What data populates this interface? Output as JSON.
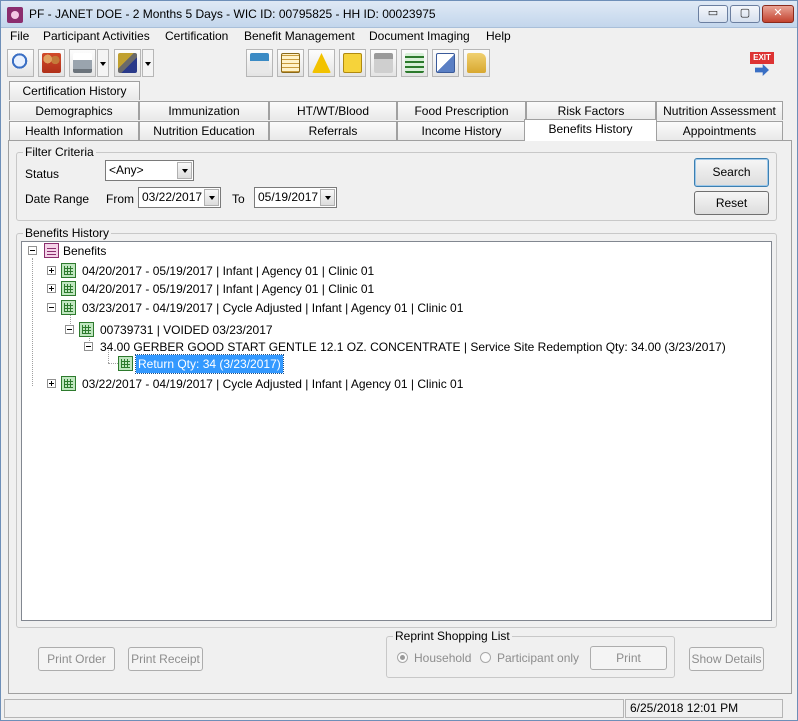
{
  "window": {
    "title": "PF - JANET DOE - 2 Months 5 Days - WIC ID: 00795825 - HH ID: 00023975",
    "minimize": "▭",
    "restore": "▢",
    "close": "✕"
  },
  "menu": [
    "File",
    "Participant Activities",
    "Certification",
    "Benefit Management",
    "Document Imaging",
    "Help"
  ],
  "toolbar": {
    "icons": [
      "search-icon",
      "family-icon",
      "printer-icon",
      "tools-icon",
      "calculator-icon",
      "calendar-icon",
      "warning-icon",
      "notes-icon",
      "card-icon",
      "check-icon",
      "documents-icon",
      "folder-icon"
    ],
    "exit_label": "EXIT"
  },
  "tabs": {
    "row1": [
      "Certification History"
    ],
    "row2": [
      "Demographics",
      "Immunization",
      "HT/WT/Blood",
      "Food Prescription",
      "Risk Factors",
      "Nutrition Assessment"
    ],
    "row3": [
      "Health Information",
      "Nutrition Education",
      "Referrals",
      "Income History",
      "Benefits History",
      "Appointments"
    ],
    "active": "Benefits History"
  },
  "filter": {
    "legend": "Filter Criteria",
    "status_label": "Status",
    "status_value": "<Any>",
    "date_range_label": "Date Range",
    "from_label": "From",
    "from_value": "03/22/2017",
    "to_label": "To",
    "to_value": "05/19/2017",
    "search_label": "Search",
    "reset_label": "Reset"
  },
  "history": {
    "legend": "Benefits History",
    "root": "Benefits",
    "rows": [
      "04/20/2017 - 05/19/2017  |  Infant  |  Agency 01  |  Clinic 01",
      "04/20/2017 - 05/19/2017  |  Infant  |  Agency 01  |  Clinic 01",
      "03/23/2017 - 04/19/2017  |  Cycle Adjusted  |  Infant  |  Agency 01  |  Clinic 01",
      "00739731  |  VOIDED 03/23/2017",
      "34.00 GERBER GOOD START GENTLE 12.1 OZ. CONCENTRATE | Service Site Redemption Qty: 34.00 (3/23/2017)",
      "Return Qty: 34 (3/23/2017)",
      "03/22/2017 - 04/19/2017  |  Cycle Adjusted  |  Infant  |  Agency 01  |  Clinic 01"
    ]
  },
  "bottom": {
    "print_order": "Print Order",
    "print_receipt": "Print Receipt",
    "reprint_legend": "Reprint Shopping List",
    "household": "Household",
    "participant_only": "Participant only",
    "print": "Print",
    "show_details": "Show Details"
  },
  "status": {
    "left": "",
    "datetime": "6/25/2018  12:01 PM"
  }
}
